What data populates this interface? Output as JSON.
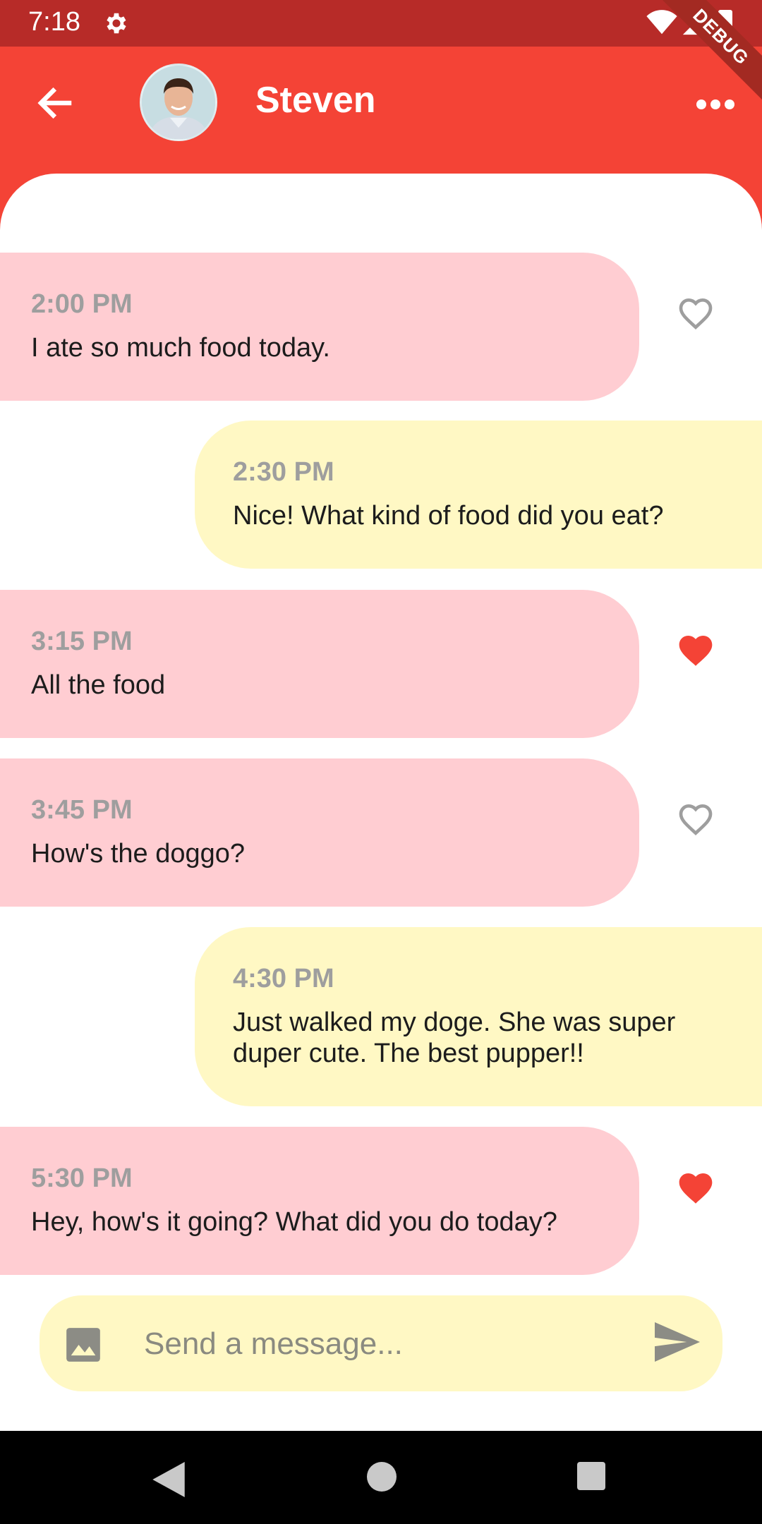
{
  "status_bar": {
    "time": "7:18",
    "debug_label": "DEBUG"
  },
  "app_bar": {
    "contact_name": "Steven"
  },
  "messages": [
    {
      "time": "2:00 PM",
      "text": "I ate so much food today.",
      "direction": "incoming",
      "liked": false
    },
    {
      "time": "2:30 PM",
      "text": "Nice! What kind of food did you eat?",
      "direction": "outgoing"
    },
    {
      "time": "3:15 PM",
      "text": "All the food",
      "direction": "incoming",
      "liked": true
    },
    {
      "time": "3:45 PM",
      "text": "How's the doggo?",
      "direction": "incoming",
      "liked": false
    },
    {
      "time": "4:30 PM",
      "text": "Just walked my doge. She was super duper cute. The best pupper!!",
      "direction": "outgoing"
    },
    {
      "time": "5:30 PM",
      "text": "Hey, how's it going? What did you do today?",
      "direction": "incoming",
      "liked": true
    }
  ],
  "composer": {
    "placeholder": "Send a message..."
  },
  "colors": {
    "primary": "#f44336",
    "status_bar": "#b72b28",
    "incoming_bubble": "#ffcdd2",
    "outgoing_bubble": "#fff8c4",
    "heart_liked": "#f44336",
    "heart_unliked": "#9e9e9e"
  },
  "icons": {
    "back": "arrow-back-icon",
    "more": "more-horiz-icon",
    "heart_outline": "heart-outline-icon",
    "heart_filled": "heart-filled-icon",
    "image": "image-icon",
    "send": "send-icon"
  }
}
